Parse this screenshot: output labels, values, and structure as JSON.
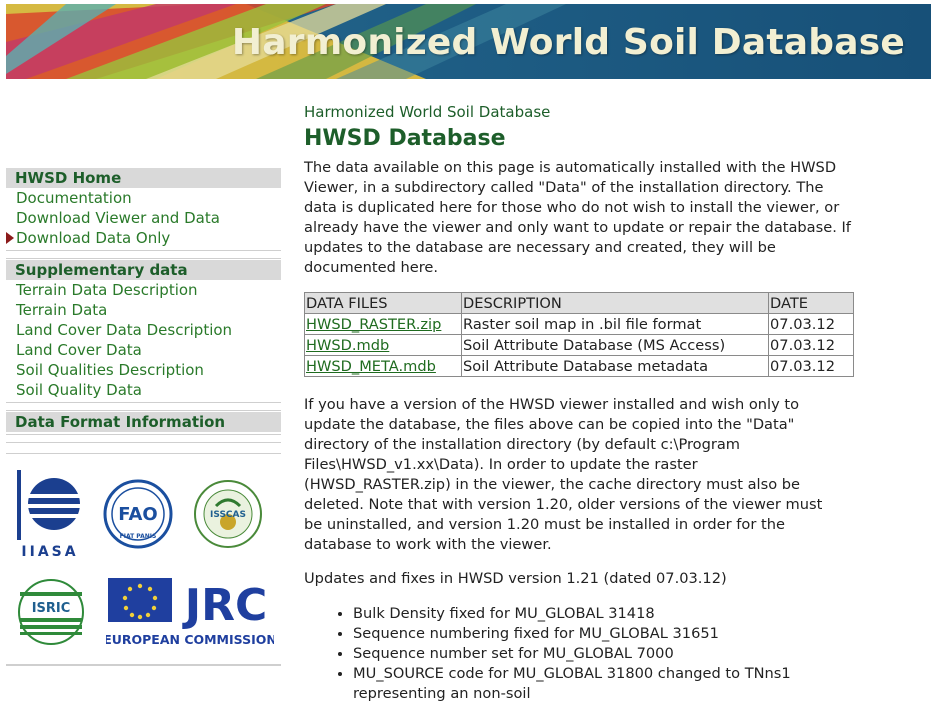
{
  "banner": {
    "title": "Harmonized World Soil Database"
  },
  "sidebar": {
    "sections": [
      {
        "heading": "HWSD Home",
        "items": [
          {
            "label": "Documentation",
            "active": false
          },
          {
            "label": "Download Viewer and Data",
            "active": false
          },
          {
            "label": "Download Data Only",
            "active": true
          }
        ]
      },
      {
        "heading": "Supplementary data",
        "items": [
          {
            "label": "Terrain Data Description"
          },
          {
            "label": "Terrain Data"
          },
          {
            "label": "Land Cover Data Description"
          },
          {
            "label": "Land Cover Data"
          },
          {
            "label": "Soil Qualities Description"
          },
          {
            "label": "Soil Quality Data"
          }
        ]
      },
      {
        "heading": "Data Format Information",
        "items": []
      }
    ],
    "logos": {
      "iiasa": "IIASA",
      "fao": "FIAT PANIS",
      "isscas": "ISSCAS",
      "isric": "ISRIC",
      "jrc": "JRC",
      "ec": "EUROPEAN COMMISSION"
    }
  },
  "main": {
    "site_name": "Harmonized World Soil Database",
    "title": "HWSD Database",
    "intro": "The data available on this page is automatically installed with the HWSD Viewer, in a subdirectory called \"Data\" of the installation directory. The data is duplicated here for those who do not wish to install the viewer, or already have the viewer and only want to update or repair the database. If updates to the database are necessary and created, they will be documented here.",
    "table": {
      "headers": [
        "DATA FILES",
        "DESCRIPTION",
        "DATE"
      ],
      "rows": [
        [
          "HWSD_RASTER.zip",
          "Raster soil map in .bil file format",
          "07.03.12"
        ],
        [
          "HWSD.mdb",
          "Soil Attribute Database (MS Access)",
          "07.03.12"
        ],
        [
          "HWSD_META.mdb",
          "Soil Attribute Database metadata",
          "07.03.12"
        ]
      ]
    },
    "after_table": "If you have a version of the HWSD viewer installed and wish only to update the database, the files above can be copied into the \"Data\" directory of the installation directory (by default c:\\Program Files\\HWSD_v1.xx\\Data). In order to update the raster (HWSD_RASTER.zip) in the viewer, the cache directory must also be deleted. Note that with version 1.20, older versions of the viewer must be uninstalled, and version 1.20 must be installed in order for the database to work with the viewer.",
    "updates_heading": "Updates and fixes in HWSD version 1.21 (dated 07.03.12)",
    "fixes": [
      "Bulk Density fixed for MU_GLOBAL 31418",
      "Sequence numbering fixed for MU_GLOBAL 31651",
      "Sequence number set for MU_GLOBAL 7000",
      "MU_SOURCE code for MU_GLOBAL 31800 changed to TNns1 representing an non-soil"
    ]
  }
}
